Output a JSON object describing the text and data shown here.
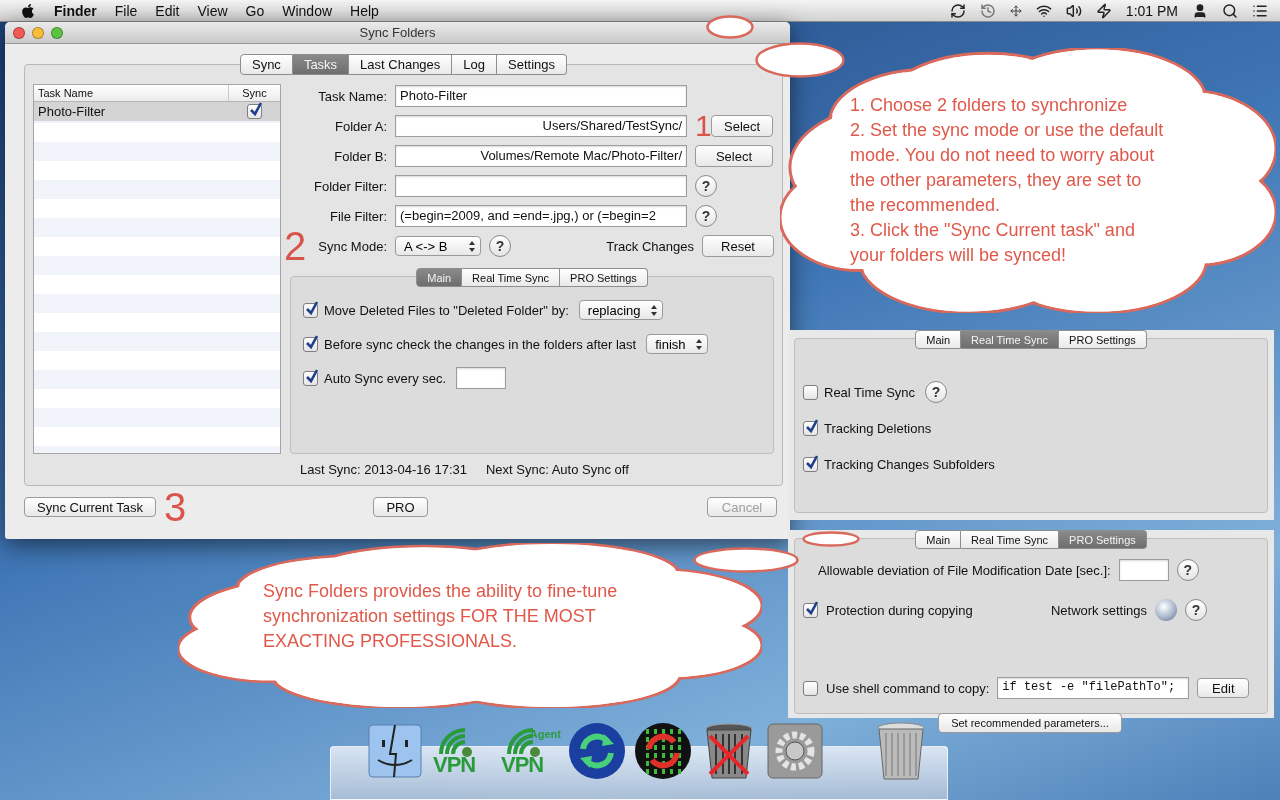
{
  "menu_bar": {
    "app_name": "Finder",
    "menus": [
      "File",
      "Edit",
      "View",
      "Go",
      "Window",
      "Help"
    ],
    "clock": "1:01 PM"
  },
  "window": {
    "title": "Sync Folders",
    "tabs": [
      {
        "label": "Sync",
        "selected": false
      },
      {
        "label": "Tasks",
        "selected": true
      },
      {
        "label": "Last Changes",
        "selected": false
      },
      {
        "label": "Log",
        "selected": false
      },
      {
        "label": "Settings",
        "selected": false
      }
    ],
    "task_table": {
      "columns": [
        "Task Name",
        "Sync"
      ],
      "rows": [
        {
          "name": "Photo-Filter",
          "sync": true,
          "selected": true
        }
      ]
    },
    "fields": [
      {
        "label": "Task Name:",
        "value": "Photo-Filter"
      },
      {
        "label": "Folder A:",
        "value": "Users/Shared/TestSync/",
        "button": "Select"
      },
      {
        "label": "Folder B:",
        "value": "Volumes/Remote Mac/Photo-Filter/",
        "button": "Select"
      },
      {
        "label": "Folder Filter:",
        "help": "?"
      },
      {
        "label": "File Filter:",
        "value": "(=begin=2009, and =end=.jpg,) or (=begin=2",
        "help": "?"
      }
    ],
    "sync_mode": {
      "label": "Sync Mode:",
      "value": "A <-> B",
      "help": "?"
    },
    "track_changes": {
      "label": "Track Changes",
      "button": "Reset"
    },
    "subtabs": [
      {
        "label": "Main",
        "selected": true
      },
      {
        "label": "Real Time Sync",
        "selected": false
      },
      {
        "label": "PRO Settings",
        "selected": false
      }
    ],
    "options": [
      {
        "kind": "select",
        "checked": true,
        "label": "Move Deleted Files to \"Deleted Folder\" by:",
        "value": "replacing"
      },
      {
        "kind": "select",
        "checked": true,
        "label": "Before sync check the changes in the folders after last",
        "value": "finish"
      },
      {
        "kind": "input",
        "checked": true,
        "label": "Auto Sync every sec."
      }
    ],
    "last_sync": "Last Sync: 2013-04-16 17:31",
    "next_sync": "Next Sync: Auto Sync off",
    "buttons": [
      {
        "label": "Sync Current Task",
        "disabled": false
      },
      {
        "label": "PRO",
        "disabled": false
      },
      {
        "label": "Cancel",
        "disabled": true
      }
    ]
  },
  "step_numbers": [
    "1",
    "2",
    "3"
  ],
  "real_time_panel": {
    "tabs": [
      {
        "label": "Main",
        "selected": false
      },
      {
        "label": "Real Time Sync",
        "selected": true
      },
      {
        "label": "PRO Settings",
        "selected": false
      }
    ],
    "options": [
      {
        "label": "Real Time Sync",
        "checked": false,
        "help": "?"
      },
      {
        "label": "Tracking Deletions",
        "checked": true
      },
      {
        "label": "Tracking Changes Subfolders",
        "checked": true
      }
    ]
  },
  "pro_panel": {
    "tabs": [
      {
        "label": "Main",
        "selected": false
      },
      {
        "label": "Real Time Sync",
        "selected": false
      },
      {
        "label": "PRO Settings",
        "selected": true
      }
    ],
    "deviation_label": "Allowable deviation of File Modification Date [sec.]:",
    "deviation_help": "?",
    "protection": {
      "label": "Protection during copying",
      "checked": true
    },
    "network_label": "Network settings",
    "network_help": "?",
    "shell": {
      "label": "Use shell command to copy:",
      "checked": false,
      "value": "if test -e \"filePathTo\";",
      "button": "Edit"
    },
    "recommended_button": "Set recommended parameters..."
  },
  "callouts": [
    {
      "lines": [
        "1. Choose 2 folders to synchronize",
        "2. Set the sync mode or use the default mode. You do not need to worry about the other parameters, they are set to the recommended.",
        "3. Click the \"Sync Current task\" and your folders will be synced!"
      ]
    },
    {
      "lines": [
        "Sync Folders provides the ability to fine-tune synchronization settings FOR THE MOST EXACTING PROFESSIONALS."
      ]
    }
  ],
  "dock": [
    {
      "kind": "finder"
    },
    {
      "kind": "vpn",
      "label": "VPN"
    },
    {
      "kind": "vpn",
      "label": "VPN",
      "badge": "Agent"
    },
    {
      "kind": "sync"
    },
    {
      "kind": "binary"
    },
    {
      "kind": "trash-x"
    },
    {
      "kind": "prefs"
    },
    {
      "kind": "trash"
    }
  ]
}
